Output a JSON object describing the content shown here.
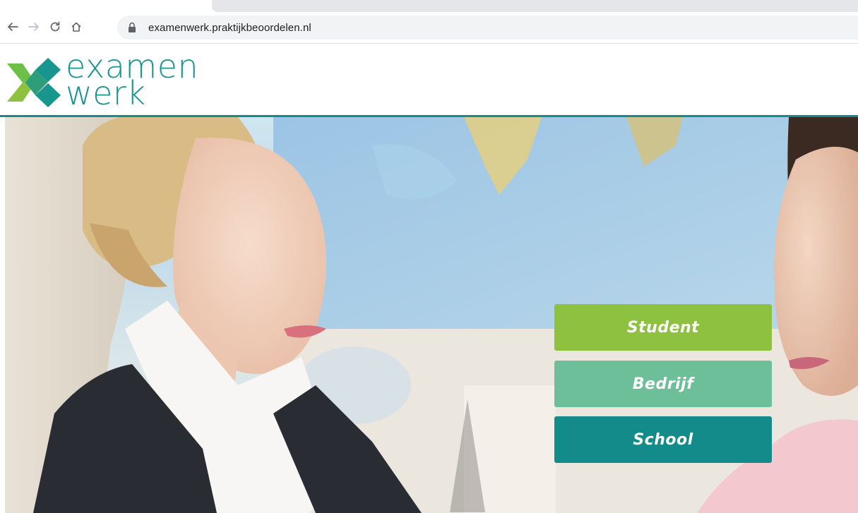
{
  "browser": {
    "url": "examenwerk.praktijkbeoordelen.nl",
    "icons": [
      "back-arrow-icon",
      "forward-arrow-icon",
      "reload-icon",
      "home-icon",
      "lock-icon"
    ]
  },
  "site": {
    "logo_line1": "examen",
    "logo_line2": "werk",
    "colors": {
      "brand_teal": "#17968f",
      "brand_green": "#8dc13f",
      "header_rule": "#178b89"
    }
  },
  "hero": {
    "buttons": [
      {
        "label": "Student",
        "color": "#8dc13f"
      },
      {
        "label": "Bedrijf",
        "color": "#6cbf98"
      },
      {
        "label": "School",
        "color": "#148b8b"
      }
    ]
  }
}
